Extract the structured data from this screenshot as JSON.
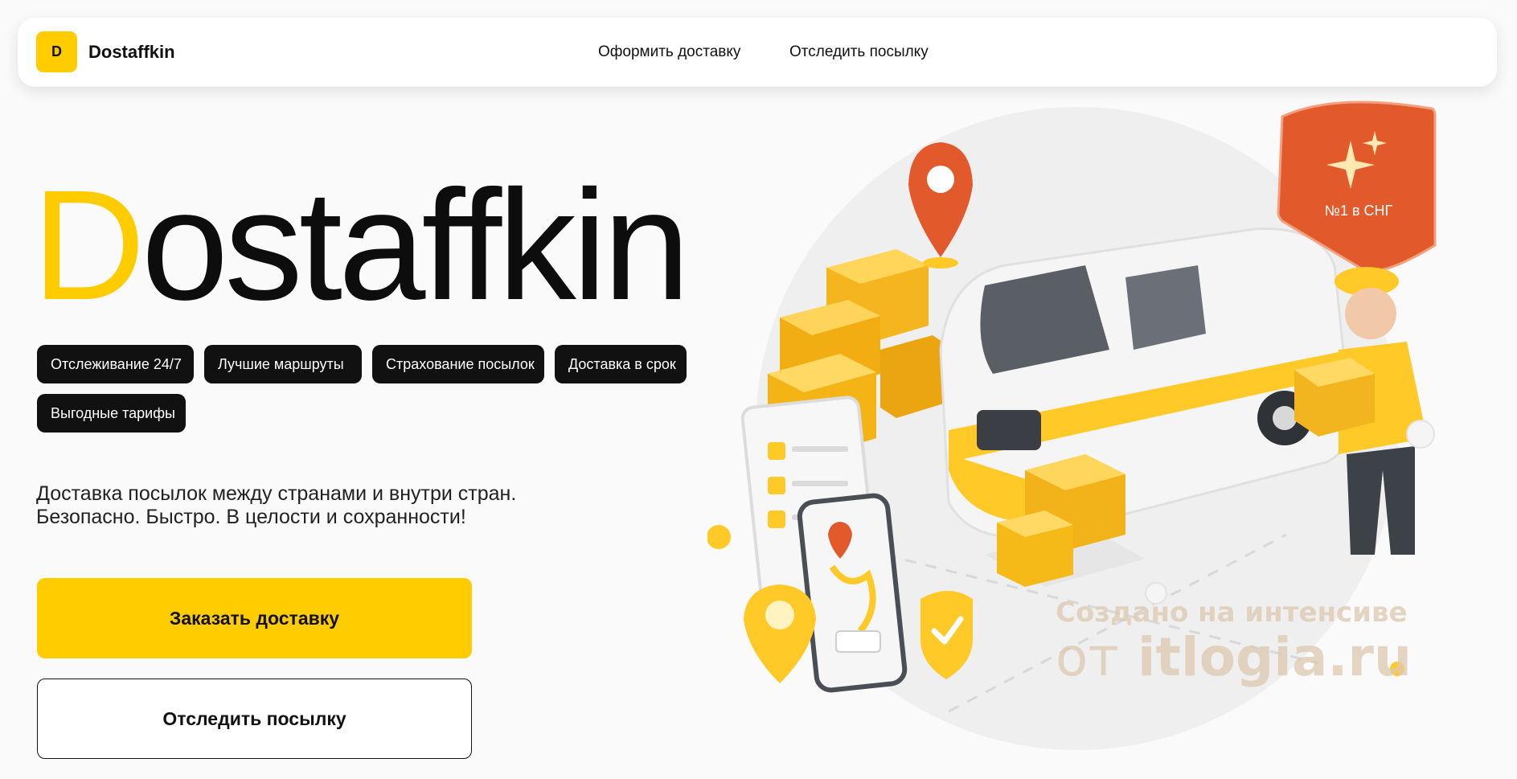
{
  "header": {
    "logo_letter": "D",
    "brand": "Dostaffkin",
    "nav": [
      {
        "label": "Оформить доставку"
      },
      {
        "label": "Отследить посылку"
      }
    ]
  },
  "hero": {
    "title_accent": "D",
    "title_rest": "ostaffkin",
    "tags": [
      "Отслеживание 24/7",
      "Лучшие маршруты",
      "Страхование посылок",
      "Доставка в срок",
      "Выгодные тарифы"
    ],
    "subtitle_line1": "Доставка посылок между странами и внутри стран.",
    "subtitle_line2": "Безопасно. Быстро. В целости и сохранности!",
    "primary_button": "Заказать доставку",
    "secondary_button": "Отследить посылку"
  },
  "illustration": {
    "badge_text": "№1 в СНГ",
    "watermark_line1": "Создано на интенсиве",
    "watermark_line2_prefix": "от",
    "watermark_line2_site": "itlogia.ru"
  },
  "colors": {
    "accent": "#ffcc00",
    "dark": "#111111",
    "badge": "#e25a2b"
  }
}
